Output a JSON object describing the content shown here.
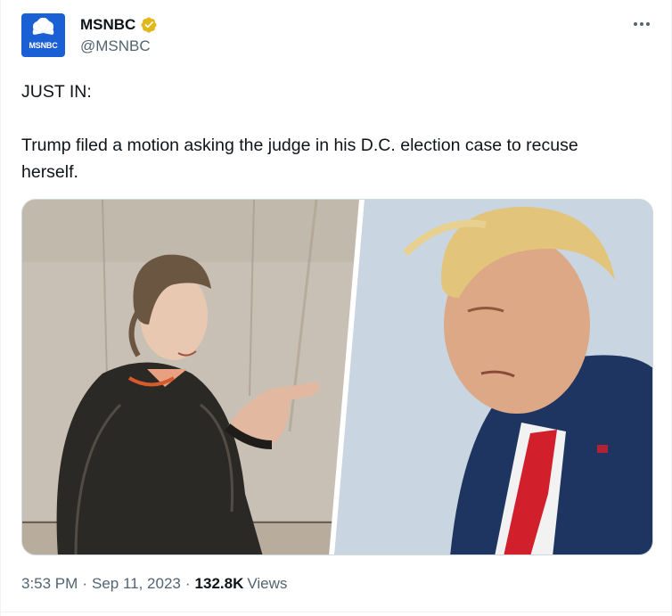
{
  "tweet": {
    "author": {
      "display_name": "MSNBC",
      "handle": "@MSNBC",
      "avatar_label": "MSNBC",
      "verified": true,
      "verified_color": "#e2b719"
    },
    "text_lines": [
      "JUST IN:",
      "Trump filed a motion asking the judge in his D.C. election case to recuse",
      "herself."
    ],
    "media": {
      "left_image": "courtroom-sketch-of-judge",
      "right_image": "photo-of-trump"
    },
    "time": "3:53 PM",
    "date": "Sep 11, 2023",
    "separator": "·",
    "views_count": "132.8K",
    "views_label": "Views"
  },
  "colors": {
    "text_primary": "#0f1419",
    "text_secondary": "#536471",
    "avatar_bg": "#1b5fd4"
  },
  "icons": {
    "more": "more-horizontal-icon",
    "verified": "verified-badge-icon",
    "logo": "peacock-logo"
  }
}
